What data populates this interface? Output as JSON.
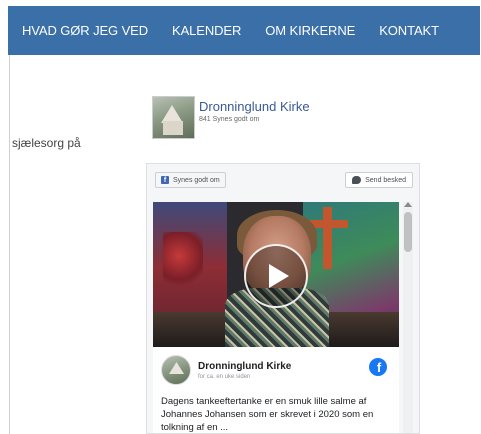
{
  "nav": {
    "items": [
      {
        "label": "HVAD GØR JEG VED"
      },
      {
        "label": "KALENDER"
      },
      {
        "label": "OM KIRKERNE"
      },
      {
        "label": "KONTAKT"
      }
    ]
  },
  "side_text": "sjælesorg på",
  "page": {
    "name": "Dronninglund Kirke",
    "likes": "841 Synes godt om"
  },
  "widget": {
    "like_label": "Synes godt om",
    "message_label": "Send besked"
  },
  "post": {
    "author": "Dronninglund Kirke",
    "time": "for ca. en uke siden",
    "text": "Dagens tankeeftertanke er en smuk lille salme af Johannes Johansen som er skrevet i 2020 som en tolkning af en ..."
  },
  "colors": {
    "nav_bg": "#3a6fa8",
    "facebook_blue": "#1877f2",
    "page_link": "#3b5998"
  },
  "icons": {
    "play": "play-icon",
    "facebook": "facebook-logo-icon",
    "like": "facebook-like-icon",
    "message": "messenger-icon"
  }
}
